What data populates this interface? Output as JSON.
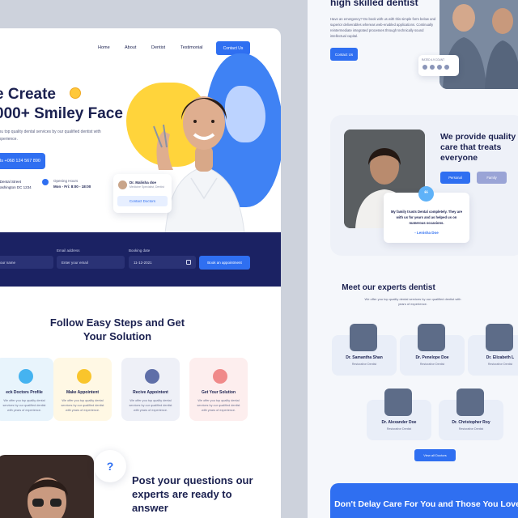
{
  "nav": {
    "items": [
      "Home",
      "About",
      "Dentist",
      "Testimonial"
    ],
    "cta": "Contact Us"
  },
  "hero": {
    "title_line1": "e Create",
    "title_line2": "000+ Smiley Face",
    "description": "you top quality dental services by our qualified dentist with experience.",
    "call_button": "ls +068 124 567 890",
    "address": "8 Dental Street Washington DC 1234",
    "hours_label": "Opening Hours",
    "hours_value": "Mon - Fri: 8:00 - 18:00"
  },
  "doctor_card": {
    "name": "Dr. Malisha doe",
    "role": "Medicine Specialist, Dentist",
    "button": "Contact Doctors"
  },
  "booking": {
    "name_label": "",
    "name_placeholder": "our name",
    "email_label": "Email address",
    "email_placeholder": "Enter your email",
    "date_label": "Booking date",
    "date_value": "11-12-2021",
    "submit": "Book an appointment"
  },
  "steps": {
    "title": "Follow Easy Steps and Get Your Solution",
    "items": [
      {
        "title": "eck Doctors Profile",
        "desc": "We offer you top quality dental services by our qualified dentist with years of experience.",
        "icon": "search-icon",
        "bg": "#e8f4fc",
        "color": "#45b3f0"
      },
      {
        "title": "Make Appointent",
        "desc": "We offer you top quality dental services by our qualified dentist with years of experience.",
        "icon": "calendar-icon",
        "bg": "#fff8e4",
        "color": "#f9c52c"
      },
      {
        "title": "Recive Appointent",
        "desc": "We offer you top quality dental services by our qualified dentist with years of experience.",
        "icon": "document-icon",
        "bg": "#eef0f7",
        "color": "#5f6fa8"
      },
      {
        "title": "Get Your Solution",
        "desc": "We offer you top quality dental services by our qualified dentist with years of experience.",
        "icon": "heart-icon",
        "bg": "#fdeeee",
        "color": "#f08a8a"
      }
    ]
  },
  "questions": {
    "title": "Post your questions our experts are ready to answer",
    "icon": "?"
  },
  "right": {
    "title": "high skilled dentist",
    "description": "Have an emergency? Do book with us with this simple form below and superior deliverables whereas web-enabled applications. Continually reintermediate integrated processes through technically sound intellectual capital.",
    "button": "Contact Us",
    "rating_label": "RATED 4.9 COUNT",
    "quality_title": "We provide quality care that treats everyone",
    "pills": [
      "Personal",
      "Family"
    ],
    "quote": "My family trusts Dental completely. They are with us for years and as helped us on numerous occasions.",
    "quote_author": "- Lenisha Doe",
    "quote_icon": "“",
    "experts_title": "Meet our experts dentist",
    "experts_desc": "We offer you top quality dental services by our qualified dentist with years of experience.",
    "doctors": [
      {
        "name": "Dr. Samantha Shan",
        "role": "Restorative Dentist"
      },
      {
        "name": "Dr. Penelope Doe",
        "role": "Restorative Dentist"
      },
      {
        "name": "Dr. Elizabeth L",
        "role": "Restorative Dentist"
      },
      {
        "name": "Dr. Alexander Doe",
        "role": "Restorative Dentist"
      },
      {
        "name": "Dr. Christopher Roy",
        "role": "Restorative Dentist"
      }
    ],
    "view_all": "View all Doctors",
    "cta_title": "Don't Delay Care For You and Those You Love"
  }
}
